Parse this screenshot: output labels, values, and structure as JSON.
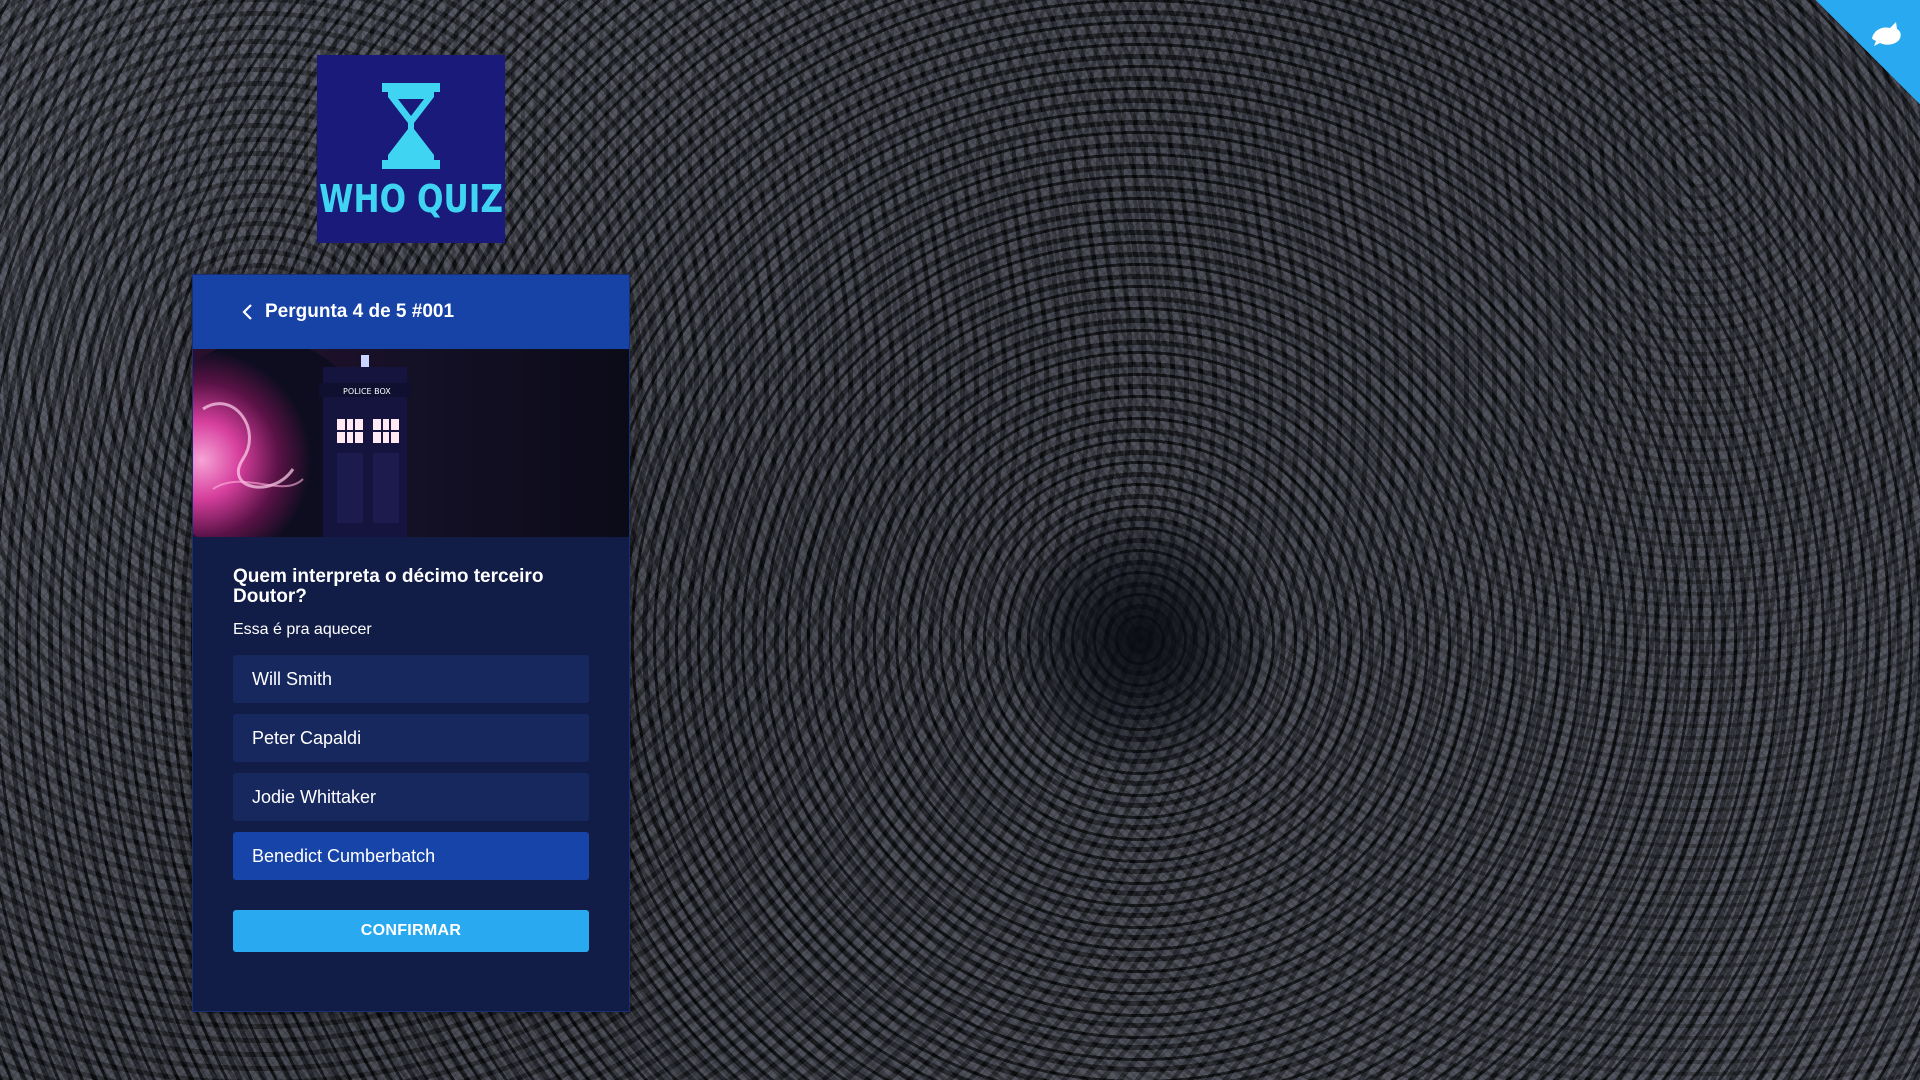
{
  "logo": {
    "text": "WHO QUIZ"
  },
  "corner_badge": {
    "icon": "bird-icon",
    "color": "#29a9ef"
  },
  "quiz": {
    "header_title": "Pergunta 4 de 5 #001",
    "back_icon": "chevron-left-icon",
    "image_description_icon": "tardis-image",
    "question": "Quem interpreta o décimo terceiro Doutor?",
    "hint": "Essa é pra aquecer",
    "options": [
      {
        "label": "Will Smith",
        "selected": false
      },
      {
        "label": "Peter Capaldi",
        "selected": false
      },
      {
        "label": "Jodie Whittaker",
        "selected": false
      },
      {
        "label": "Benedict Cumberbatch",
        "selected": true
      }
    ],
    "confirm_label": "CONFIRMAR"
  },
  "colors": {
    "header": "#1742a6",
    "card": "#111c47",
    "option": "#16285e",
    "option_selected": "#1744a8",
    "confirm": "#29a9ef",
    "logo_bg": "#1a1a7a",
    "logo_accent": "#3fd4f2"
  }
}
